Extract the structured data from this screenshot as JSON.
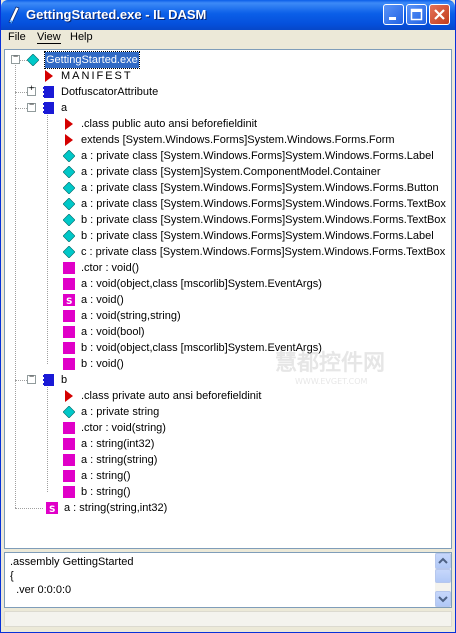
{
  "window": {
    "title": "GettingStarted.exe - IL DASM",
    "minimize_label": "minimize",
    "maximize_label": "maximize",
    "close_label": "close"
  },
  "menu": [
    "File",
    "View",
    "Help"
  ],
  "tree": {
    "root": "GettingStarted.exe",
    "manifest": "MANIFEST",
    "dotfuscator": "DotfuscatorAttribute",
    "class_a": "a",
    "a_items": [
      ".class public auto ansi beforefieldinit",
      "extends [System.Windows.Forms]System.Windows.Forms.Form",
      "a : private class [System.Windows.Forms]System.Windows.Forms.Label",
      "a : private class [System]System.ComponentModel.Container",
      "a : private class [System.Windows.Forms]System.Windows.Forms.Button",
      "a : private class [System.Windows.Forms]System.Windows.Forms.TextBox",
      "b : private class [System.Windows.Forms]System.Windows.Forms.TextBox",
      "b : private class [System.Windows.Forms]System.Windows.Forms.Label",
      "c : private class [System.Windows.Forms]System.Windows.Forms.TextBox",
      ".ctor : void()",
      "a : void(object,class [mscorlib]System.EventArgs)",
      "a : void()",
      "a : void(string,string)",
      "a : void(bool)",
      "b : void(object,class [mscorlib]System.EventArgs)",
      "b : void()"
    ],
    "class_b": "b",
    "b_items": [
      ".class private auto ansi beforefieldinit",
      "a : private string",
      ".ctor : void(string)",
      "a : string(int32)",
      "a : string(string)",
      "a : string()",
      "b : string()"
    ],
    "global_method": "a : string(string,int32)"
  },
  "info": {
    "line1": ".assembly GettingStarted",
    "line2": "{",
    "line3": "  .ver 0:0:0:0"
  },
  "watermark": {
    "cn": "慧都控件网",
    "url": "WWW.EVGET.COM"
  },
  "colors": {
    "title_bar": "#0550dc",
    "selection": "#316ac5",
    "class_icon": "#1a1ad6",
    "field_icon": "#00c8c8",
    "method_icon": "#e000c8",
    "decl_icon": "#d40000"
  }
}
